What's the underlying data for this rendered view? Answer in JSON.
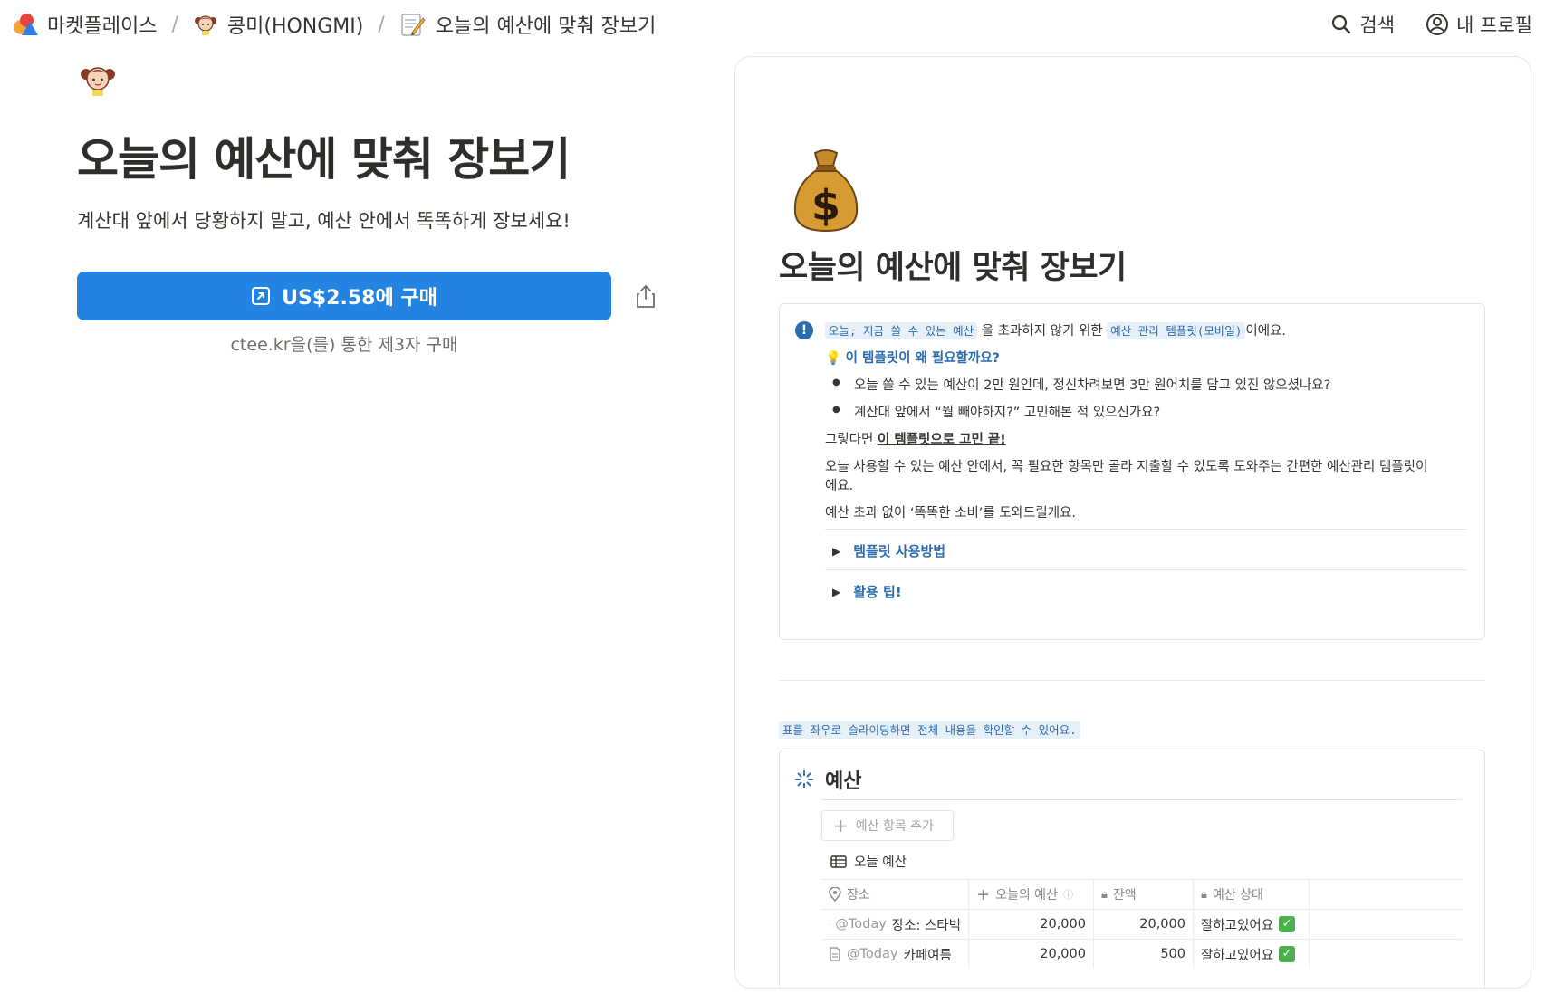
{
  "breadcrumb": {
    "marketplace": "마켓플레이스",
    "separator": "/",
    "creator": "콩미(HONGMI)",
    "page": "오늘의 예산에 맞춰 장보기"
  },
  "top_actions": {
    "search": "검색",
    "profile": "내 프로필"
  },
  "product": {
    "title": "오늘의 예산에 맞춰 장보기",
    "subtitle": "계산대 앞에서 당황하지 말고, 예산 안에서 똑똑하게 장보세요!",
    "buy_label": "US$2.58에 구매",
    "third_party": "ctee.kr을(를) 통한 제3자 구매"
  },
  "preview": {
    "title": "오늘의 예산에 맞춰 장보기",
    "callout": {
      "hl1": "오늘, 지금 쓸 수 있는 예산",
      "text1": "을 초과하지 않기 위한",
      "hl2": "예산 관리 템플릿(모바일)",
      "text2": "이에요.",
      "question": "이 템플릿이 왜 필요할까요?",
      "bullet1": "오늘 쓸 수 있는 예산이 2만 원인데, 정신차려보면 3만 원어치를 담고 있진 않으셨나요?",
      "bullet2": "계산대 앞에서 “뭘 빼야하지?” 고민해본 적 있으신가요?",
      "then_prefix": "그렇다면 ",
      "then_link": "이 템플릿으로 고민 끝!",
      "para1a": "오늘 사용할 수 있는 예산 안에서, 꼭 필요한 항목만 골라 지출할 수 있도록 도와주는 간편한 예산관리 템플릿이",
      "para1b": "에요.",
      "para2": "예산 초과 없이 ‘똑똑한 소비’를 도와드릴게요.",
      "toggle1": "템플릿 사용방법",
      "toggle2": "활용 팁!"
    },
    "tip": "표를 좌우로 슬라이딩하면 전체 내용을 확인할 수 있어요.",
    "database": {
      "title": "예산",
      "add_label": "예산 항목 추가",
      "view_label": "오늘 예산",
      "columns": [
        "장소",
        "오늘의 예산",
        "잔액",
        "예산 상태"
      ],
      "rows": [
        {
          "mention": "@Today",
          "place": "장소: 스타벅",
          "budget": "20,000",
          "balance": "20,000",
          "status": "잘하고있어요"
        },
        {
          "mention": "@Today",
          "place": "카페여름",
          "budget": "20,000",
          "balance": "500",
          "status": "잘하고있어요"
        }
      ]
    }
  },
  "colors": {
    "accent": "#2383e2",
    "link_blue": "#2b6cb0",
    "highlight_bg": "#e7f0f8"
  }
}
